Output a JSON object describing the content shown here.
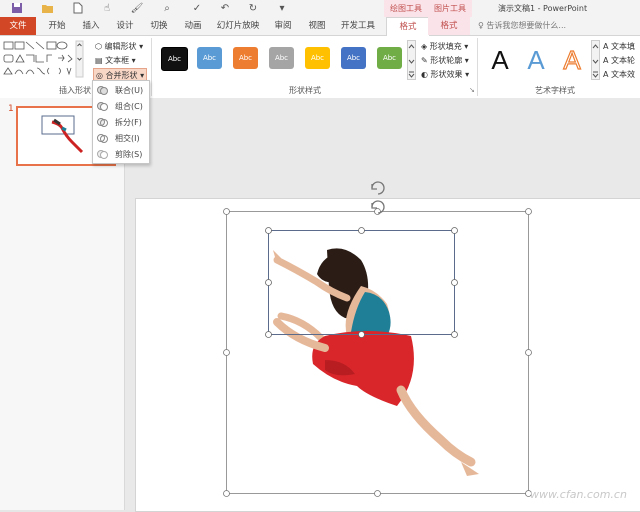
{
  "window": {
    "title": "演示文稿1 - PowerPoint",
    "context_tabs": [
      "绘图工具",
      "图片工具"
    ]
  },
  "tabs": [
    "文件",
    "开始",
    "插入",
    "设计",
    "切换",
    "动画",
    "幻灯片放映",
    "审阅",
    "视图",
    "开发工具",
    "格式",
    "格式"
  ],
  "tell_me": "告诉我您想要做什么...",
  "ribbon": {
    "insert_shapes": {
      "label": "插入形状",
      "edit_shape": "编辑形状",
      "text_box": "文本框",
      "merge_shapes": "合并形状"
    },
    "shape_styles": {
      "label": "形状样式",
      "swatch_text": "Abc",
      "fill": "形状填充",
      "outline": "形状轮廓",
      "effects": "形状效果",
      "swatches": [
        "#111111",
        "#5b9bd5",
        "#ed7d31",
        "#a5a5a5",
        "#ffc000",
        "#4472c4",
        "#70ad47"
      ]
    },
    "wordart": {
      "label": "艺术字样式",
      "letter": "A",
      "text_fill": "文本填",
      "text_outline": "文本轮",
      "text_effects": "文本效"
    }
  },
  "merge_menu": [
    "联合(U)",
    "组合(C)",
    "拆分(F)",
    "相交(I)",
    "剪除(S)"
  ],
  "slides": {
    "current_number": "1"
  },
  "watermark": "www.cfan.com.cn",
  "colors": {
    "file_tab": "#d24726",
    "accent_red": "#c0504d",
    "dress": "#d9262b",
    "top": "#1f7f97"
  }
}
